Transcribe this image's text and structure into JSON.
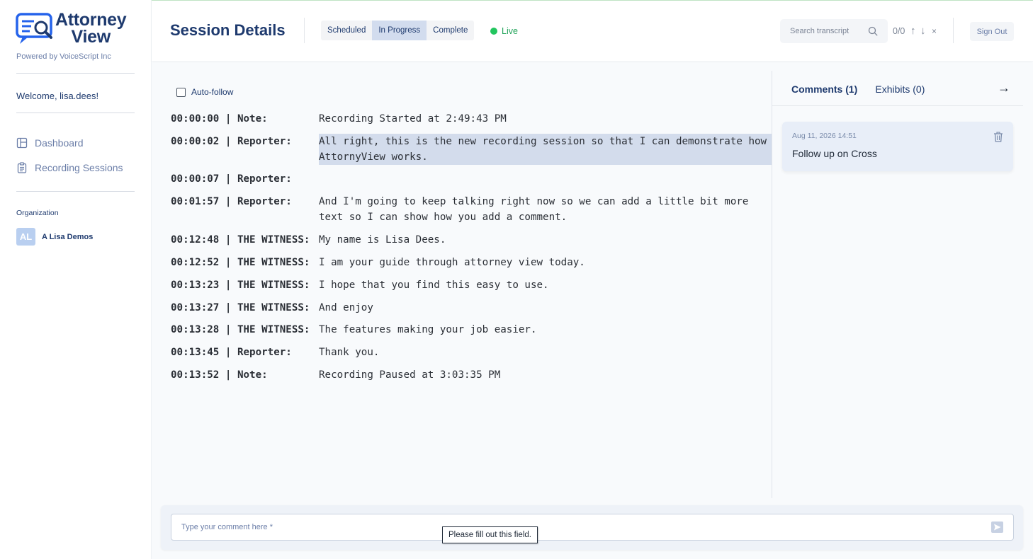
{
  "brand": {
    "logo_line1": "Attorney",
    "logo_line2": "View",
    "powered_by": "Powered by VoiceScript Inc",
    "logo_icon": "chat-search-icon",
    "color": "#1e3a6e"
  },
  "sidebar": {
    "welcome": "Welcome, lisa.dees!",
    "nav": [
      {
        "label": "Dashboard",
        "icon": "dashboard-icon"
      },
      {
        "label": "Recording Sessions",
        "icon": "clipboard-icon"
      }
    ],
    "organization_title": "Organization",
    "organization": {
      "initials": "AL",
      "name": "A Lisa Demos"
    }
  },
  "header": {
    "title": "Session Details",
    "status_tabs": [
      "Scheduled",
      "In Progress",
      "Complete"
    ],
    "active_status": "In Progress",
    "live_label": "Live",
    "live_color": "#22c55e",
    "search_placeholder": "Search transcript",
    "match_count": "0/0",
    "prev_symbol": "↑",
    "next_symbol": "↓",
    "clear_symbol": "×",
    "sign_out": "Sign Out"
  },
  "transcript": {
    "auto_follow_label": "Auto-follow",
    "auto_follow_checked": false,
    "lines": [
      {
        "meta": "00:00:00 | Note:",
        "text": "Recording Started at 2:49:43 PM"
      },
      {
        "meta": "00:00:02 | Reporter:",
        "text": "All right, this is the new recording session so that I can demonstrate how AttornyView works.",
        "highlight": true
      },
      {
        "meta": "00:00:07 | Reporter:",
        "text": ""
      },
      {
        "meta": "00:01:57 | Reporter:",
        "text": "And I'm going to keep talking right now so we can add a little bit more text so I can show how you add a comment."
      },
      {
        "meta": "00:12:48 | THE WITNESS:",
        "text": "My name is Lisa Dees."
      },
      {
        "meta": "00:12:52 | THE WITNESS:",
        "text": "I am your guide through attorney view today."
      },
      {
        "meta": "00:13:23 | THE WITNESS:",
        "text": "I hope that you find this easy to use."
      },
      {
        "meta": "00:13:27 | THE WITNESS:",
        "text": "And enjoy"
      },
      {
        "meta": "00:13:28 | THE WITNESS:",
        "text": "The features making your job easier."
      },
      {
        "meta": "00:13:45 | Reporter:",
        "text": "Thank you."
      },
      {
        "meta": "00:13:52 | Note:",
        "text": "Recording Paused at 3:03:35 PM"
      }
    ],
    "highlight_color": "#d3dcec"
  },
  "panel": {
    "tabs": [
      "Comments (1)",
      "Exhibits (0)"
    ],
    "collapse_symbol": "→",
    "comments": [
      {
        "date": "Aug 11, 2026 14:51",
        "text": "Follow up on Cross"
      }
    ]
  },
  "comment_input": {
    "placeholder": "Type your comment here *",
    "value": "",
    "validation_tooltip": "Please fill out this field."
  }
}
